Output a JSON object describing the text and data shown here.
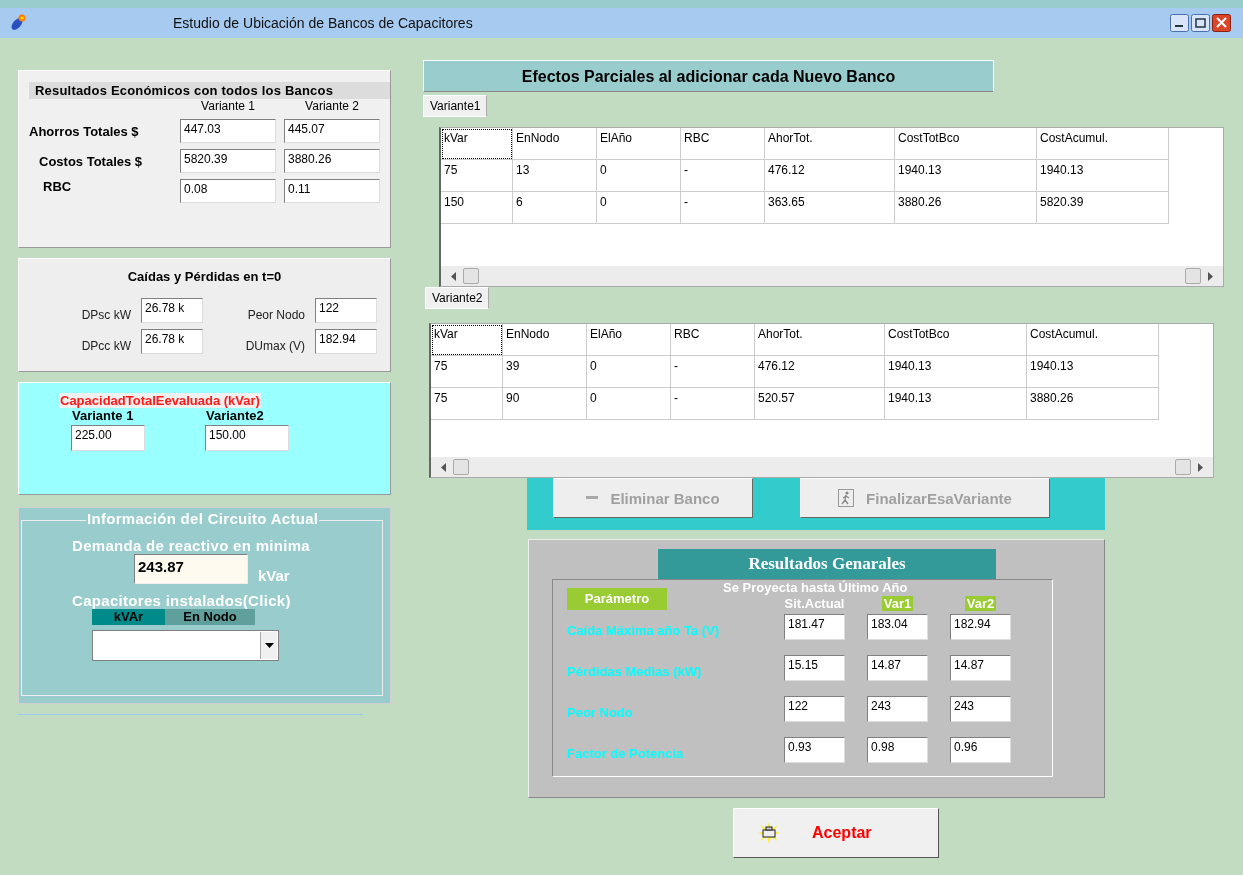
{
  "window": {
    "title": "Estudio de Ubicación de Bancos de Capacitores"
  },
  "economic": {
    "title": "Resultados Económicos con todos los Bancos",
    "columns": [
      "Variante 1",
      "Variante 2"
    ],
    "rows": [
      {
        "label": "Ahorros Totales $",
        "values": [
          "447.03",
          "445.07"
        ]
      },
      {
        "label": "Costos Totales $",
        "values": [
          "5820.39",
          "3880.26"
        ]
      },
      {
        "label": "RBC",
        "values": [
          "0.08",
          "0.11"
        ]
      }
    ]
  },
  "losses": {
    "title": "Caídas y Pérdidas en t=0",
    "fields": [
      {
        "label": "DPsc kW",
        "value": "26.78 k"
      },
      {
        "label": "Peor Nodo",
        "value": "122"
      },
      {
        "label": "DPcc kW",
        "value": "26.78 k"
      },
      {
        "label": "DUmax (V)",
        "value": "182.94"
      }
    ]
  },
  "capacity": {
    "title": "CapacidadTotalEevaluada (kVar)",
    "fields": [
      {
        "label": "Variante 1",
        "value": "225.00"
      },
      {
        "label": "Variante2",
        "value": "150.00"
      }
    ]
  },
  "circuit": {
    "title": "Información del Circuito Actual",
    "demand_label": "Demanda de reactivo en minima",
    "demand_value": "243.87",
    "demand_unit": "kVar",
    "installed_label": "Capacitores instalados(Click)",
    "installed_columns": [
      "kVAr",
      "En Nodo"
    ]
  },
  "partial": {
    "title": "Efectos Parciales  al adicionar cada Nuevo Banco",
    "variants": [
      {
        "tab": "Variante1",
        "columns": [
          "kVar",
          "EnNodo",
          "ElAño",
          "RBC",
          "AhorTot.",
          "CostTotBco",
          "CostAcumul."
        ],
        "rows": [
          [
            "75",
            "13",
            "0",
            "-",
            "476.12",
            "1940.13",
            "1940.13"
          ],
          [
            "150",
            "6",
            "0",
            "-",
            "363.65",
            "3880.26",
            "5820.39"
          ]
        ]
      },
      {
        "tab": "Variante2",
        "columns": [
          "kVar",
          "EnNodo",
          "ElAño",
          "RBC",
          "AhorTot.",
          "CostTotBco",
          "CostAcumul."
        ],
        "rows": [
          [
            "75",
            "39",
            "0",
            "-",
            "476.12",
            "1940.13",
            "1940.13"
          ],
          [
            "75",
            "90",
            "0",
            "-",
            "520.57",
            "1940.13",
            "3880.26"
          ]
        ]
      }
    ]
  },
  "actions": [
    {
      "kind": "remove",
      "label": "Eliminar Banco",
      "disabled": true
    },
    {
      "kind": "finish",
      "label": "FinalizarEsaVariante",
      "disabled": true
    }
  ],
  "general": {
    "title": "Resultados Genarales",
    "param_label": "Parámetro",
    "projection_label": "Se Proyecta hasta Último  Año",
    "columns": [
      {
        "label": "Sit.Actual",
        "highlighted": false
      },
      {
        "label": "Var1",
        "highlighted": true
      },
      {
        "label": "Var2",
        "highlighted": true
      }
    ],
    "rows": [
      {
        "label": "Caída Máxima año Ta (V)",
        "values": [
          "181.47",
          "183.04",
          "182.94"
        ]
      },
      {
        "label": "Pérdidas Medias (kW)",
        "values": [
          "15.15",
          "14.87",
          "14.87"
        ]
      },
      {
        "label": "Peor Nodo",
        "values": [
          "122",
          "243",
          "243"
        ]
      },
      {
        "label": "Factor de Potencia",
        "values": [
          "0.93",
          "0.98",
          "0.96"
        ]
      }
    ]
  },
  "accept_button": {
    "label": "Aceptar"
  }
}
